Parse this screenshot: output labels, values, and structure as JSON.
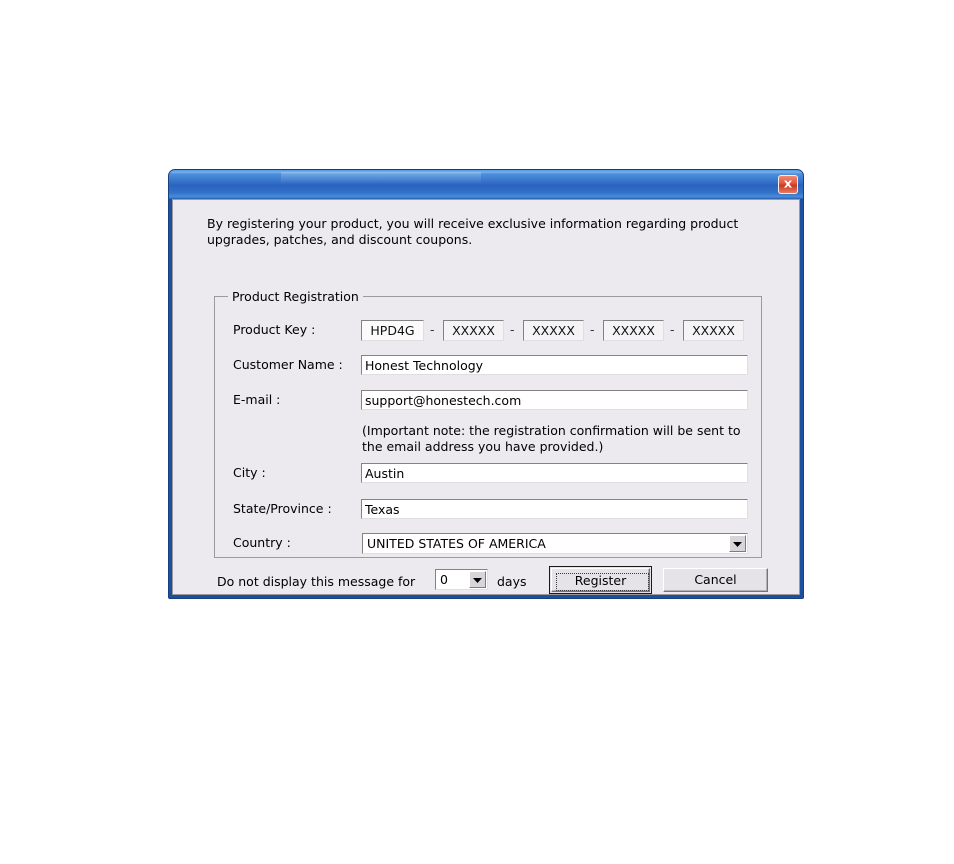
{
  "window": {
    "title": "",
    "close_icon": "close-icon"
  },
  "intro": {
    "text": "By registering your product, you will receive exclusive information regarding product upgrades, patches, and discount coupons."
  },
  "group": {
    "legend": "Product Registration",
    "fields": {
      "product_key": {
        "label": "Product Key :",
        "segments": [
          "HPD4G",
          "XXXXX",
          "XXXXX",
          "XXXXX",
          "XXXXX"
        ],
        "separator": "-"
      },
      "customer_name": {
        "label": "Customer Name :",
        "value": "Honest Technology",
        "placeholder": ""
      },
      "email": {
        "label": "E-mail :",
        "value": "support@honestech.com",
        "placeholder": ""
      },
      "email_note": "(Important note: the registration confirmation will be sent to the email address you have provided.)",
      "city": {
        "label": "City :",
        "value": "Austin",
        "placeholder": ""
      },
      "state": {
        "label": "State/Province :",
        "value": "Texas",
        "placeholder": ""
      },
      "country": {
        "label": "Country     :",
        "value": "UNITED STATES OF AMERICA",
        "dropdown_icon": "chevron-down-icon"
      }
    }
  },
  "footer": {
    "suppress_prefix": "Do not display this message for",
    "days_value": "0",
    "days_suffix": "days",
    "register_label": "Register",
    "cancel_label": "Cancel"
  },
  "colors": {
    "titlebar_blue": "#2a63bf",
    "close_red": "#c93a22",
    "dialog_face": "#ece9ef",
    "window_border": "#1d4fa0"
  }
}
